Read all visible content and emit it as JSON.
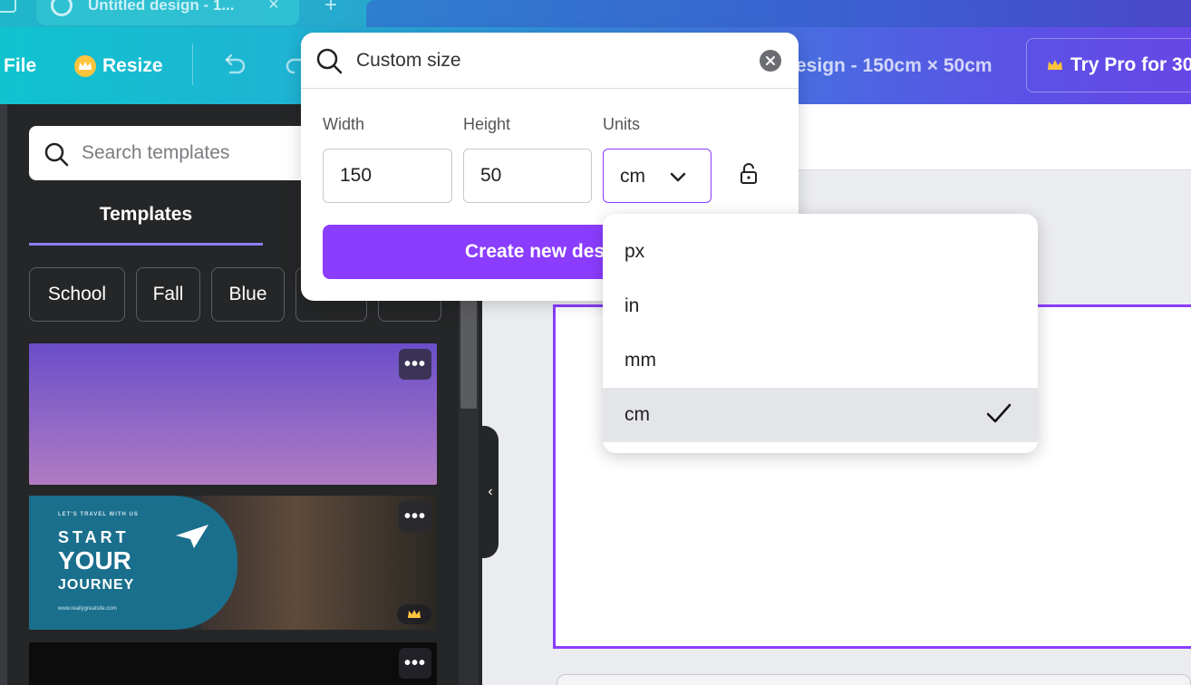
{
  "browser": {
    "tab_title": "Untitled design - 1...",
    "tab_close": "×",
    "new_tab": "+"
  },
  "header": {
    "file": "File",
    "resize": "Resize",
    "design_title": "esign - 150cm × 50cm",
    "try_pro": "Try Pro for 30"
  },
  "sidebar": {
    "search_placeholder": "Search templates",
    "tab_label": "Templates",
    "chips": [
      "School",
      "Fall",
      "Blue",
      "",
      ""
    ],
    "collapse_glyph": "‹"
  },
  "templates": [
    {
      "menu": "•••"
    },
    {
      "menu": "•••",
      "tagline": "LET'S TRAVEL WITH US",
      "line1": "START",
      "line2": "YOUR",
      "line3": "JOURNEY",
      "url": "www.reallygreatsite.com",
      "badge": "crown"
    },
    {
      "menu": "•••"
    }
  ],
  "custom_size": {
    "search_text": "Custom size",
    "width_label": "Width",
    "height_label": "Height",
    "units_label": "Units",
    "width_value": "150",
    "height_value": "50",
    "units_value": "cm",
    "create_label": "Create new des"
  },
  "units_menu": {
    "options": [
      "px",
      "in",
      "mm",
      "cm"
    ],
    "selected": "cm"
  },
  "colors": {
    "accent": "#8b3dff",
    "panel": "#252627",
    "crown": "#ffc43d"
  }
}
